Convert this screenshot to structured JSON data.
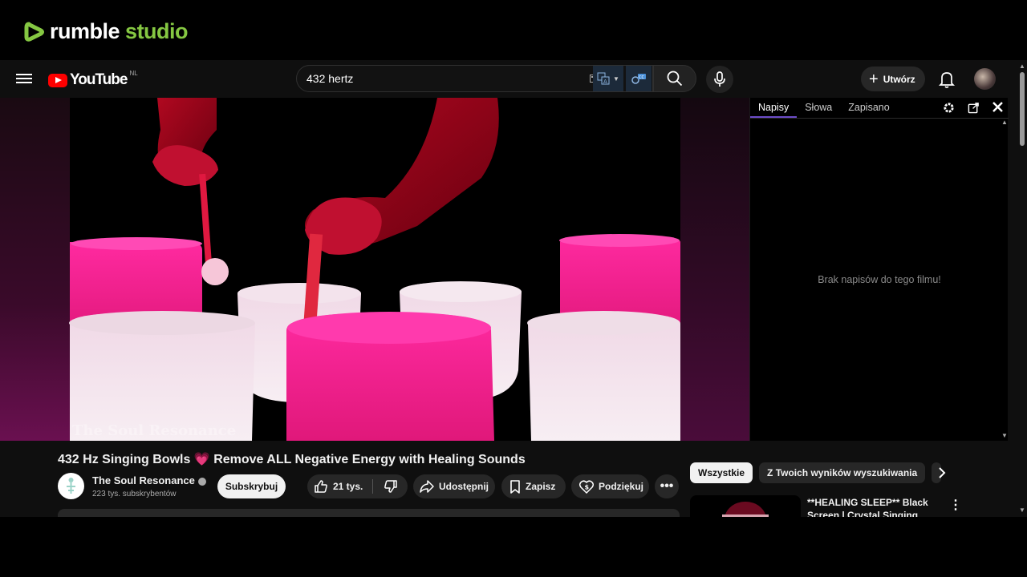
{
  "rumble": {
    "brand_white": "rumble",
    "brand_green": "studio"
  },
  "masthead": {
    "logo_text": "YouTube",
    "country_code": "NL",
    "search_value": "432 hertz",
    "create_label": "Utwórz"
  },
  "side_panel": {
    "tabs": [
      {
        "label": "Napisy",
        "active": true
      },
      {
        "label": "Słowa",
        "active": false
      },
      {
        "label": "Zapisano",
        "active": false
      }
    ],
    "empty_message": "Brak napisów do tego filmu!"
  },
  "video": {
    "watermark": "The Soul Resonance",
    "title_part1": "432 Hz Singing Bowls",
    "title_emoji": "💗",
    "title_part2": "Remove ALL Negative Energy with Healing Sounds"
  },
  "channel": {
    "name": "The Soul Resonance",
    "subscribers": "223 tys. subskrybentów",
    "subscribe_label": "Subskrybuj"
  },
  "actions": {
    "likes": "21 tys.",
    "share": "Udostępnij",
    "save": "Zapisz",
    "thanks": "Podziękuj"
  },
  "chips": [
    "Wszystkie",
    "Z Twoich wyników wyszukiwania"
  ],
  "recommendation": {
    "title": "**HEALING SLEEP** Black Screen | Crystal Singing Bowls"
  },
  "colors": {
    "rumble_green": "#85c742",
    "youtube_red": "#ff0000",
    "bowl_pink": "#e0187a",
    "tab_underline": "#6c4cc8"
  }
}
